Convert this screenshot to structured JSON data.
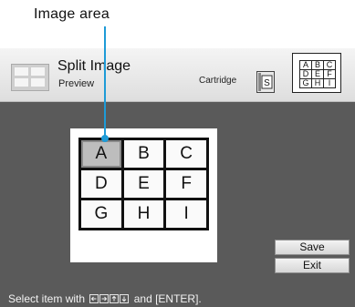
{
  "callout": {
    "label": "Image area"
  },
  "header": {
    "title": "Split Image",
    "subtitle": "Preview",
    "cartridge_label": "Cartridge",
    "cartridge_letter": "S",
    "mini_layout": [
      "A",
      "B",
      "C",
      "D",
      "E",
      "F",
      "G",
      "H",
      "I"
    ]
  },
  "grid": {
    "cells": [
      "A",
      "B",
      "C",
      "D",
      "E",
      "F",
      "G",
      "H",
      "I"
    ],
    "selected": "A"
  },
  "buttons": {
    "save": "Save",
    "exit": "Exit"
  },
  "status": {
    "prefix": "Select item with",
    "suffix": "and [ENTER]."
  },
  "colors": {
    "accent": "#1e9bd7",
    "screen": "#5a5a5a"
  }
}
